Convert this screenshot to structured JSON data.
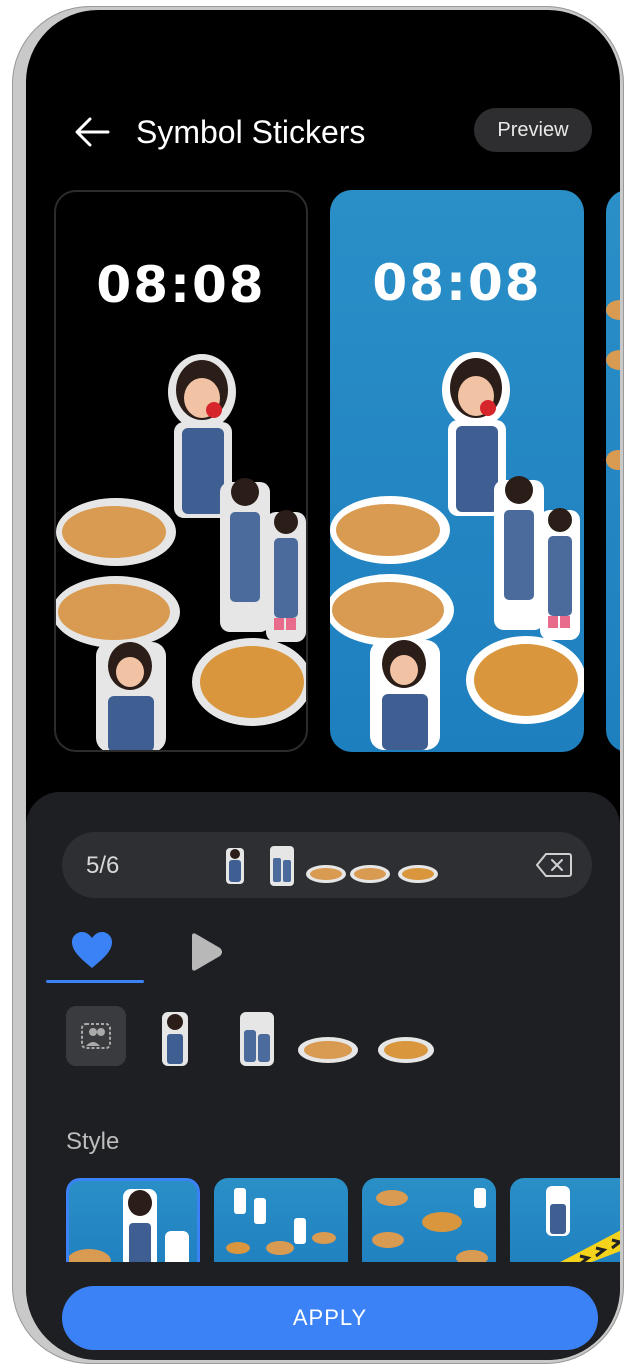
{
  "header": {
    "title": "Symbol Stickers",
    "preview_label": "Preview"
  },
  "previews": [
    {
      "clock": "08:08",
      "theme": "black"
    },
    {
      "clock": "08:08",
      "theme": "blue"
    }
  ],
  "selection": {
    "count": "5/6"
  },
  "style": {
    "label": "Style"
  },
  "apply_label": "APPLY",
  "colors": {
    "accent": "#3b82f6",
    "wallpaper_blue": "#2a8fc7",
    "panel": "#1e1f22"
  }
}
